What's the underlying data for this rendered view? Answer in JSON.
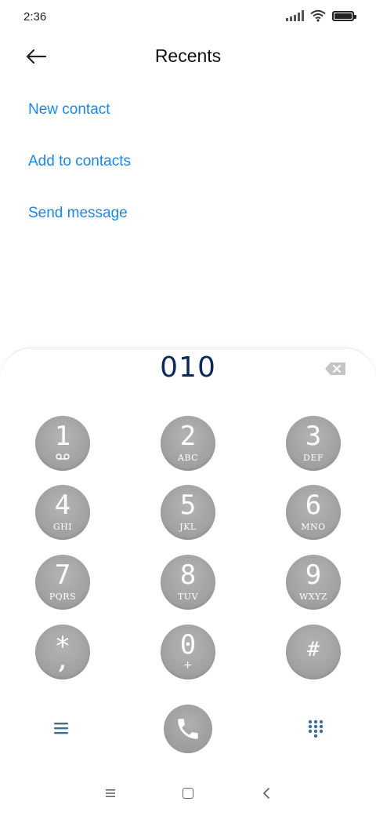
{
  "status_bar": {
    "time": "2:36",
    "icons": [
      "signal-icon",
      "wifi-icon",
      "battery-icon"
    ]
  },
  "header": {
    "title": "Recents",
    "back_icon": "arrow-left-icon"
  },
  "actions": [
    {
      "label": "New contact"
    },
    {
      "label": "Add to contacts"
    },
    {
      "label": "Send message"
    }
  ],
  "dialer": {
    "number": "010",
    "backspace_icon": "backspace-icon",
    "keys": [
      {
        "digit": "1",
        "letters": "",
        "icon": "voicemail-icon"
      },
      {
        "digit": "2",
        "letters": "ABC"
      },
      {
        "digit": "3",
        "letters": "DEF"
      },
      {
        "digit": "4",
        "letters": "GHI"
      },
      {
        "digit": "5",
        "letters": "JKL"
      },
      {
        "digit": "6",
        "letters": "MNO"
      },
      {
        "digit": "7",
        "letters": "PQRS"
      },
      {
        "digit": "8",
        "letters": "TUV"
      },
      {
        "digit": "9",
        "letters": "WXYZ"
      },
      {
        "digit": "*",
        "letters": ","
      },
      {
        "digit": "0",
        "letters": "+"
      },
      {
        "digit": "#",
        "letters": ""
      }
    ],
    "bottom": {
      "menu_icon": "menu-icon",
      "call_icon": "phone-icon",
      "keypad_icon": "dialpad-icon"
    }
  },
  "colors": {
    "accent": "#1b87e6",
    "number_text": "#0e2a5c",
    "key_fill": "#a6a6a6",
    "bottom_icon": "#3d6f96"
  },
  "nav_bar": {
    "icons": [
      "recents-nav-icon",
      "home-nav-icon",
      "back-nav-icon"
    ]
  }
}
